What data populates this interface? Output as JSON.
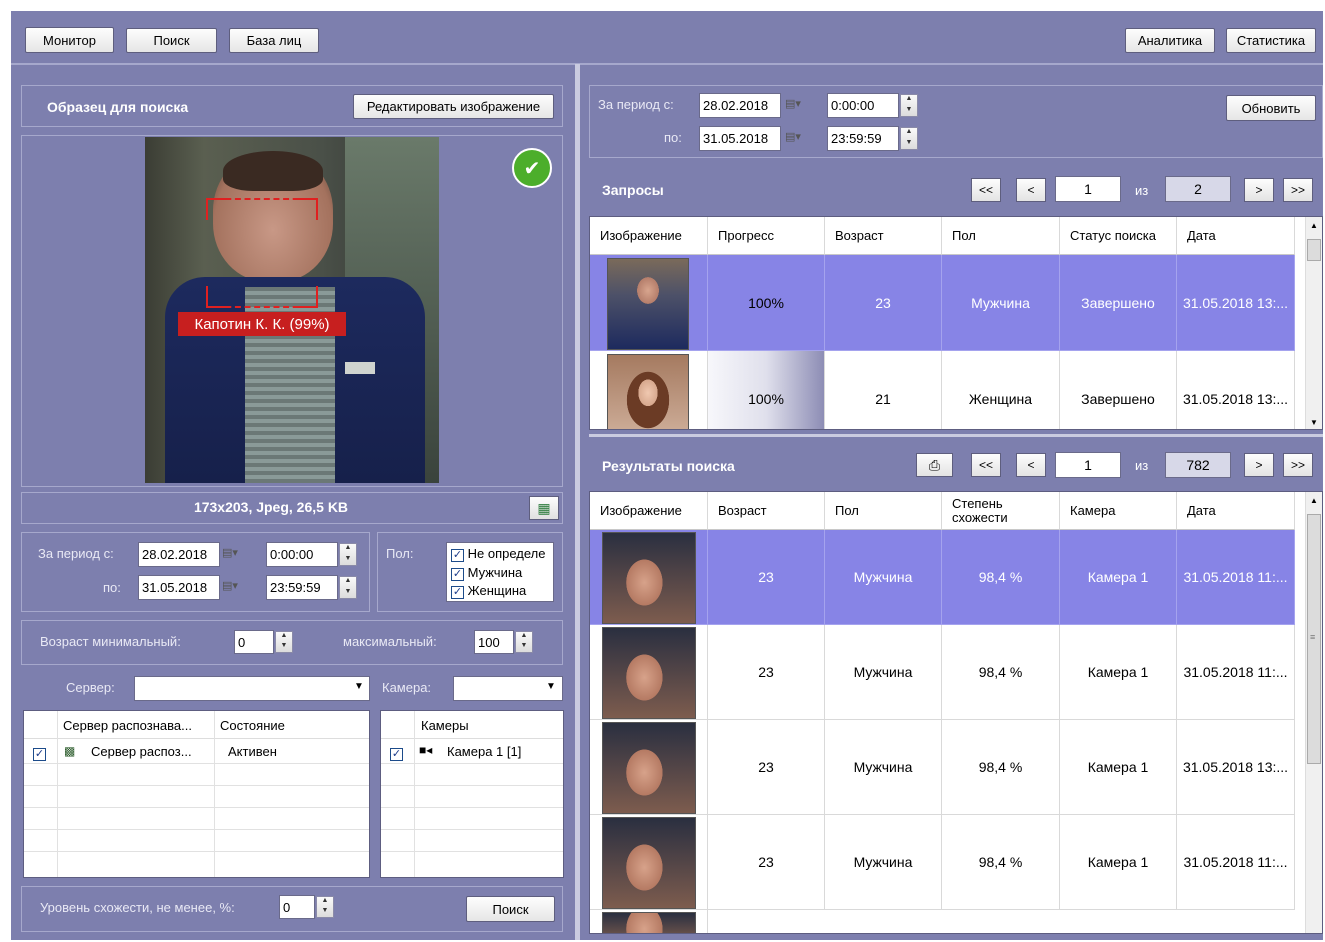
{
  "toolbar": {
    "monitor": "Монитор",
    "search": "Поиск",
    "face_base": "База лиц",
    "analytics": "Аналитика",
    "statistics": "Статистика"
  },
  "sample": {
    "title": "Образец для поиска",
    "edit_button": "Редактировать изображение",
    "face_label": "Капотин К. К. (99%)",
    "image_info": "173x203, Jpeg, 26,5 KB"
  },
  "left_filter": {
    "period_label": "За период с:",
    "to_label": "по:",
    "date_from": "28.02.2018",
    "time_from": "0:00:00",
    "date_to": "31.05.2018",
    "time_to": "23:59:59",
    "gender_label": "Пол:",
    "gender_options": [
      "Не определе",
      "Мужчина",
      "Женщина"
    ],
    "age_min_label": "Возраст минимальный:",
    "age_min": "0",
    "age_max_label": "максимальный:",
    "age_max": "100",
    "server_label": "Сервер:",
    "camera_label": "Камера:",
    "similarity_label": "Уровень схожести, не менее, %:",
    "similarity": "0",
    "search_button": "Поиск"
  },
  "servers_table": {
    "headers": [
      "Сервер распознава...",
      "Состояние"
    ],
    "rows": [
      {
        "name": "Сервер распоз...",
        "state": "Активен"
      }
    ]
  },
  "cameras_table": {
    "header": "Камеры",
    "rows": [
      {
        "name": "Камера 1 [1]"
      }
    ]
  },
  "right_filter": {
    "period_label": "За период с:",
    "to_label": "по:",
    "date_from": "28.02.2018",
    "time_from": "0:00:00",
    "date_to": "31.05.2018",
    "time_to": "23:59:59",
    "refresh_button": "Обновить"
  },
  "requests": {
    "title": "Запросы",
    "pager": {
      "first": "<<",
      "prev": "<",
      "page": "1",
      "of": "из",
      "total": "2",
      "next": ">",
      "last": ">>"
    },
    "headers": [
      "Изображение",
      "Прогресс",
      "Возраст",
      "Пол",
      "Статус поиска",
      "Дата"
    ],
    "rows": [
      {
        "progress": "100%",
        "age": "23",
        "gender": "Мужчина",
        "status": "Завершено",
        "date": "31.05.2018 13:..."
      },
      {
        "progress": "100%",
        "age": "21",
        "gender": "Женщина",
        "status": "Завершено",
        "date": "31.05.2018 13:..."
      }
    ]
  },
  "results": {
    "title": "Результаты поиска",
    "pager": {
      "first": "<<",
      "prev": "<",
      "page": "1",
      "of": "из",
      "total": "782",
      "next": ">",
      "last": ">>"
    },
    "headers": [
      "Изображение",
      "Возраст",
      "Пол",
      "Степень схожести",
      "Камера",
      "Дата"
    ],
    "rows": [
      {
        "age": "23",
        "gender": "Мужчина",
        "similarity": "98,4 %",
        "camera": "Камера 1",
        "date": "31.05.2018 11:..."
      },
      {
        "age": "23",
        "gender": "Мужчина",
        "similarity": "98,4 %",
        "camera": "Камера 1",
        "date": "31.05.2018 11:..."
      },
      {
        "age": "23",
        "gender": "Мужчина",
        "similarity": "98,4 %",
        "camera": "Камера 1",
        "date": "31.05.2018 13:..."
      },
      {
        "age": "23",
        "gender": "Мужчина",
        "similarity": "98,4 %",
        "camera": "Камера 1",
        "date": "31.05.2018 11:..."
      }
    ]
  },
  "colors": {
    "background": "#7d7fae",
    "selected_row": "#8784e6",
    "face_box": "#e02020"
  }
}
